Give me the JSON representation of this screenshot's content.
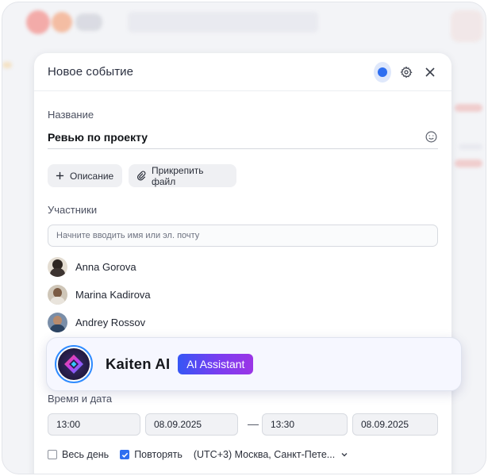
{
  "modal": {
    "title": "Новое событие",
    "name_label": "Название",
    "name_value": "Ревью по проекту",
    "description_button": "Описание",
    "attach_button": "Прикрепить файл",
    "participants_label": "Участники",
    "search_placeholder": "Начните вводить имя или эл. почту",
    "participants": [
      {
        "name": "Anna Gorova"
      },
      {
        "name": "Marina Kadirova"
      },
      {
        "name": "Andrey Rossov"
      }
    ],
    "datetime_label": "Время и дата",
    "start_time": "13:00",
    "start_date": "08.09.2025",
    "dash": "—",
    "end_time": "13:30",
    "end_date": "08.09.2025",
    "all_day_label": "Весь день",
    "all_day_checked": false,
    "repeat_label": "Повторять",
    "repeat_checked": true,
    "timezone_value": "(UTC+3) Москва, Санкт-Пете..."
  },
  "ai_card": {
    "name": "Kaiten AI",
    "badge": "AI Assistant"
  },
  "colors": {
    "accent": "#2f6ff0",
    "badge_gradient_start": "#3656f5",
    "badge_gradient_end": "#9b35e6"
  },
  "icons": [
    "color-dot-icon",
    "gear-icon",
    "close-icon",
    "smiley-icon",
    "plus-icon",
    "paperclip-icon",
    "chevron-down-icon",
    "checkmark-icon",
    "kaiten-ai-logo-icon"
  ]
}
